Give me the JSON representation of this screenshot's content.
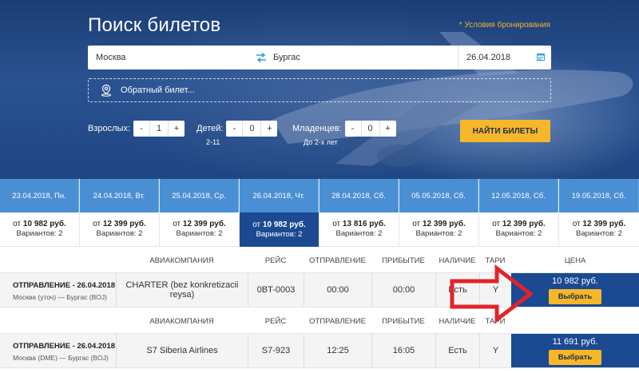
{
  "search": {
    "title": "Поиск билетов",
    "terms_link": "* Условия бронирования",
    "from": "Москва",
    "to": "Бургас",
    "date": "26.04.2018",
    "return_ticket": "Обратный билет...",
    "adults_label": "Взрослых:",
    "adults": "1",
    "children_label": "Детей:",
    "children": "0",
    "children_sub": "2-11",
    "infants_label": "Младенцев:",
    "infants": "0",
    "infants_sub": "До 2-х лет",
    "minus": "-",
    "plus": "+",
    "find_button": "НАЙТИ БИЛЕТЫ"
  },
  "date_strip": [
    {
      "date": "23.04.2018, Пн.",
      "from": "от",
      "price": "10 982 руб.",
      "variants": "Вариантов: 2",
      "active": false
    },
    {
      "date": "24.04.2018, Вт.",
      "from": "от",
      "price": "12 399 руб.",
      "variants": "Вариантов: 2",
      "active": false
    },
    {
      "date": "25.04.2018, Ср.",
      "from": "от",
      "price": "12 399 руб.",
      "variants": "Вариантов: 2",
      "active": false
    },
    {
      "date": "26.04.2018, Чт.",
      "from": "от",
      "price": "10 982 руб.",
      "variants": "Вариантов: 2",
      "active": true
    },
    {
      "date": "28.04.2018, Сб.",
      "from": "от",
      "price": "13 816 руб.",
      "variants": "Вариантов: 2",
      "active": false
    },
    {
      "date": "05.05.2018, Сб.",
      "from": "от",
      "price": "12 399 руб.",
      "variants": "Вариантов: 2",
      "active": false
    },
    {
      "date": "12.05.2018, Сб.",
      "from": "от",
      "price": "12 399 руб.",
      "variants": "Вариантов: 2",
      "active": false
    },
    {
      "date": "19.05.2018, Сб.",
      "from": "от",
      "price": "12 399 руб.",
      "variants": "Вариантов: 2",
      "active": false
    }
  ],
  "columns": {
    "airline": "АВИАКОМПАНИЯ",
    "flight": "РЕЙС",
    "departure": "ОТПРАВЛЕНИЕ",
    "arrival": "ПРИБЫТИЕ",
    "availability": "НАЛИЧИЕ",
    "tariff": "ТАРИ",
    "price": "ЦЕНА"
  },
  "results": [
    {
      "dep_title": "ОТПРАВЛЕНИЕ - 26.04.2018",
      "route": "Москва (уточ) — Бургас (BOJ)",
      "airline": "CHARTER (bez konkretizacii reysa)",
      "flight": "0BT-0003",
      "dep_time": "00:00",
      "arr_time": "00:00",
      "availability": "Есть",
      "tariff": "Y",
      "price": "10 982 руб.",
      "choose": "Выбрать"
    },
    {
      "dep_title": "ОТПРАВЛЕНИЕ - 26.04.2018",
      "route": "Москва (DME) — Бургас (BOJ)",
      "airline": "S7 Siberia Airlines",
      "flight": "S7-923",
      "dep_time": "12:25",
      "arr_time": "16:05",
      "availability": "Есть",
      "tariff": "Y",
      "price": "11 691 руб.",
      "choose": "Выбрать"
    }
  ],
  "colors": {
    "accent": "#f7b72a",
    "date_header": "#4a8fd4",
    "active_blue": "#1b4a93",
    "annotation_arrow": "#e0242a"
  }
}
